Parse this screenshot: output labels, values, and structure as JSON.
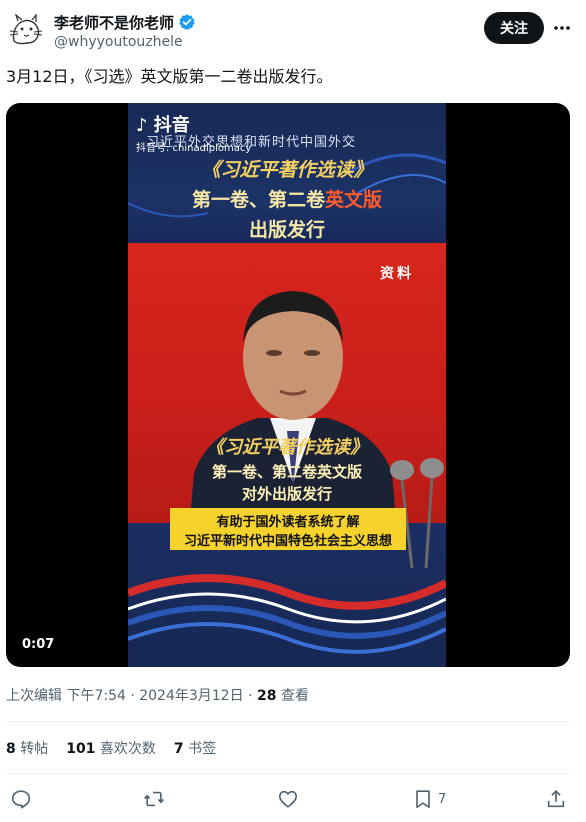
{
  "author": {
    "display_name": "李老师不是你老师",
    "handle": "@whyyoutouzhele",
    "verified": true
  },
  "follow_label": "关注",
  "tweet_text": "3月12日，《习选》英文版第一二卷出版发行。",
  "video": {
    "duration": "0:07",
    "watermark": "抖音",
    "watermark_id": "抖音号: chinadiplomacy",
    "banner_text": "习近平外交思想和新时代中国外交",
    "top_title_1": "《习近平著作选读》",
    "top_title_2_a": "第一卷、第二卷",
    "top_title_2_b": "英文版",
    "top_title_3": "出版发行",
    "ziliao": "资料",
    "mid_title_1": "《习近平著作选读》",
    "mid_title_2": "第一卷、第二卷英文版",
    "mid_title_3": "对外出版发行",
    "caption_1": "有助于国外读者系统了解",
    "caption_2": "习近平新时代中国特色社会主义思想"
  },
  "meta": {
    "edited_prefix": "上次编辑 下午7:54 · 2024年3月12日 · ",
    "views_count": "28",
    "views_label": " 查看"
  },
  "stats": {
    "retweets_count": "8",
    "retweets_label": " 转帖",
    "likes_count": "101",
    "likes_label": " 喜欢次数",
    "bookmarks_count": "7",
    "bookmarks_label": " 书签"
  },
  "actions": {
    "bookmark_count": "7"
  },
  "colors": {
    "text_primary": "#0f1419",
    "text_secondary": "#536471",
    "verified_blue": "#1d9bf0",
    "divider": "#eff3f4"
  },
  "icons": [
    "verified-badge-icon",
    "more-icon",
    "reply-icon",
    "retweet-icon",
    "like-icon",
    "bookmark-icon",
    "share-icon"
  ]
}
